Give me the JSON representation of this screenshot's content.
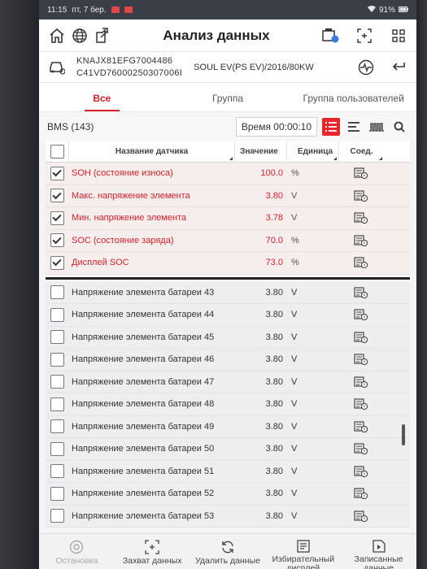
{
  "status_bar": {
    "time": "11:15",
    "date": "пт, 7 бер.",
    "battery": "91%"
  },
  "header": {
    "title": "Анализ данных"
  },
  "vehicle": {
    "vin_line1": "KNAJX81EFG7004486",
    "vin_line2": "C41VD76000250307006I",
    "model": "SOUL EV(PS EV)/2016/80KW"
  },
  "tabs": [
    {
      "label": "Все",
      "active": true
    },
    {
      "label": "Группа",
      "active": false
    },
    {
      "label": "Группа пользователей",
      "active": false
    }
  ],
  "toolbar": {
    "group_label": "BMS (143)",
    "time_label": "Время 00:00:10"
  },
  "table": {
    "headers": {
      "name": "Название датчика",
      "value": "Значение",
      "unit": "Единица",
      "connect": "Соед."
    },
    "selected_rows": [
      {
        "name": "SOH (состояние износа)",
        "value": "100.0",
        "unit": "%"
      },
      {
        "name": "Макс. напряжение элемента",
        "value": "3.80",
        "unit": "V"
      },
      {
        "name": "Мин. напряжение элемента",
        "value": "3.78",
        "unit": "V"
      },
      {
        "name": "SOC (состояние заряда)",
        "value": "70.0",
        "unit": "%"
      },
      {
        "name": "Дисплей SOC",
        "value": "73.0",
        "unit": "%"
      }
    ],
    "rows": [
      {
        "name": "Напряжение элемента батареи 43",
        "value": "3.80",
        "unit": "V"
      },
      {
        "name": "Напряжение элемента батареи 44",
        "value": "3.80",
        "unit": "V"
      },
      {
        "name": "Напряжение элемента батареи 45",
        "value": "3.80",
        "unit": "V"
      },
      {
        "name": "Напряжение элемента батареи 46",
        "value": "3.80",
        "unit": "V"
      },
      {
        "name": "Напряжение элемента батареи 47",
        "value": "3.80",
        "unit": "V"
      },
      {
        "name": "Напряжение элемента батареи 48",
        "value": "3.80",
        "unit": "V"
      },
      {
        "name": "Напряжение элемента батареи 49",
        "value": "3.80",
        "unit": "V"
      },
      {
        "name": "Напряжение элемента батареи 50",
        "value": "3.80",
        "unit": "V"
      },
      {
        "name": "Напряжение элемента батареи 51",
        "value": "3.80",
        "unit": "V"
      },
      {
        "name": "Напряжение элемента батареи 52",
        "value": "3.80",
        "unit": "V"
      },
      {
        "name": "Напряжение элемента батареи 53",
        "value": "3.80",
        "unit": "V"
      }
    ]
  },
  "bottom_bar": [
    {
      "label": "Остановка",
      "icon": "stop-icon",
      "disabled": true
    },
    {
      "label": "Захват данных",
      "icon": "capture-icon",
      "disabled": false
    },
    {
      "label": "Удалить данные",
      "icon": "refresh-icon",
      "disabled": false
    },
    {
      "label": "Избирательный дисплей",
      "icon": "selective-display-icon",
      "disabled": false
    },
    {
      "label": "Записанные данные",
      "icon": "recorded-data-icon",
      "disabled": false
    }
  ],
  "colors": {
    "accent": "#d8202a",
    "status_bar": "#3a3f47"
  }
}
